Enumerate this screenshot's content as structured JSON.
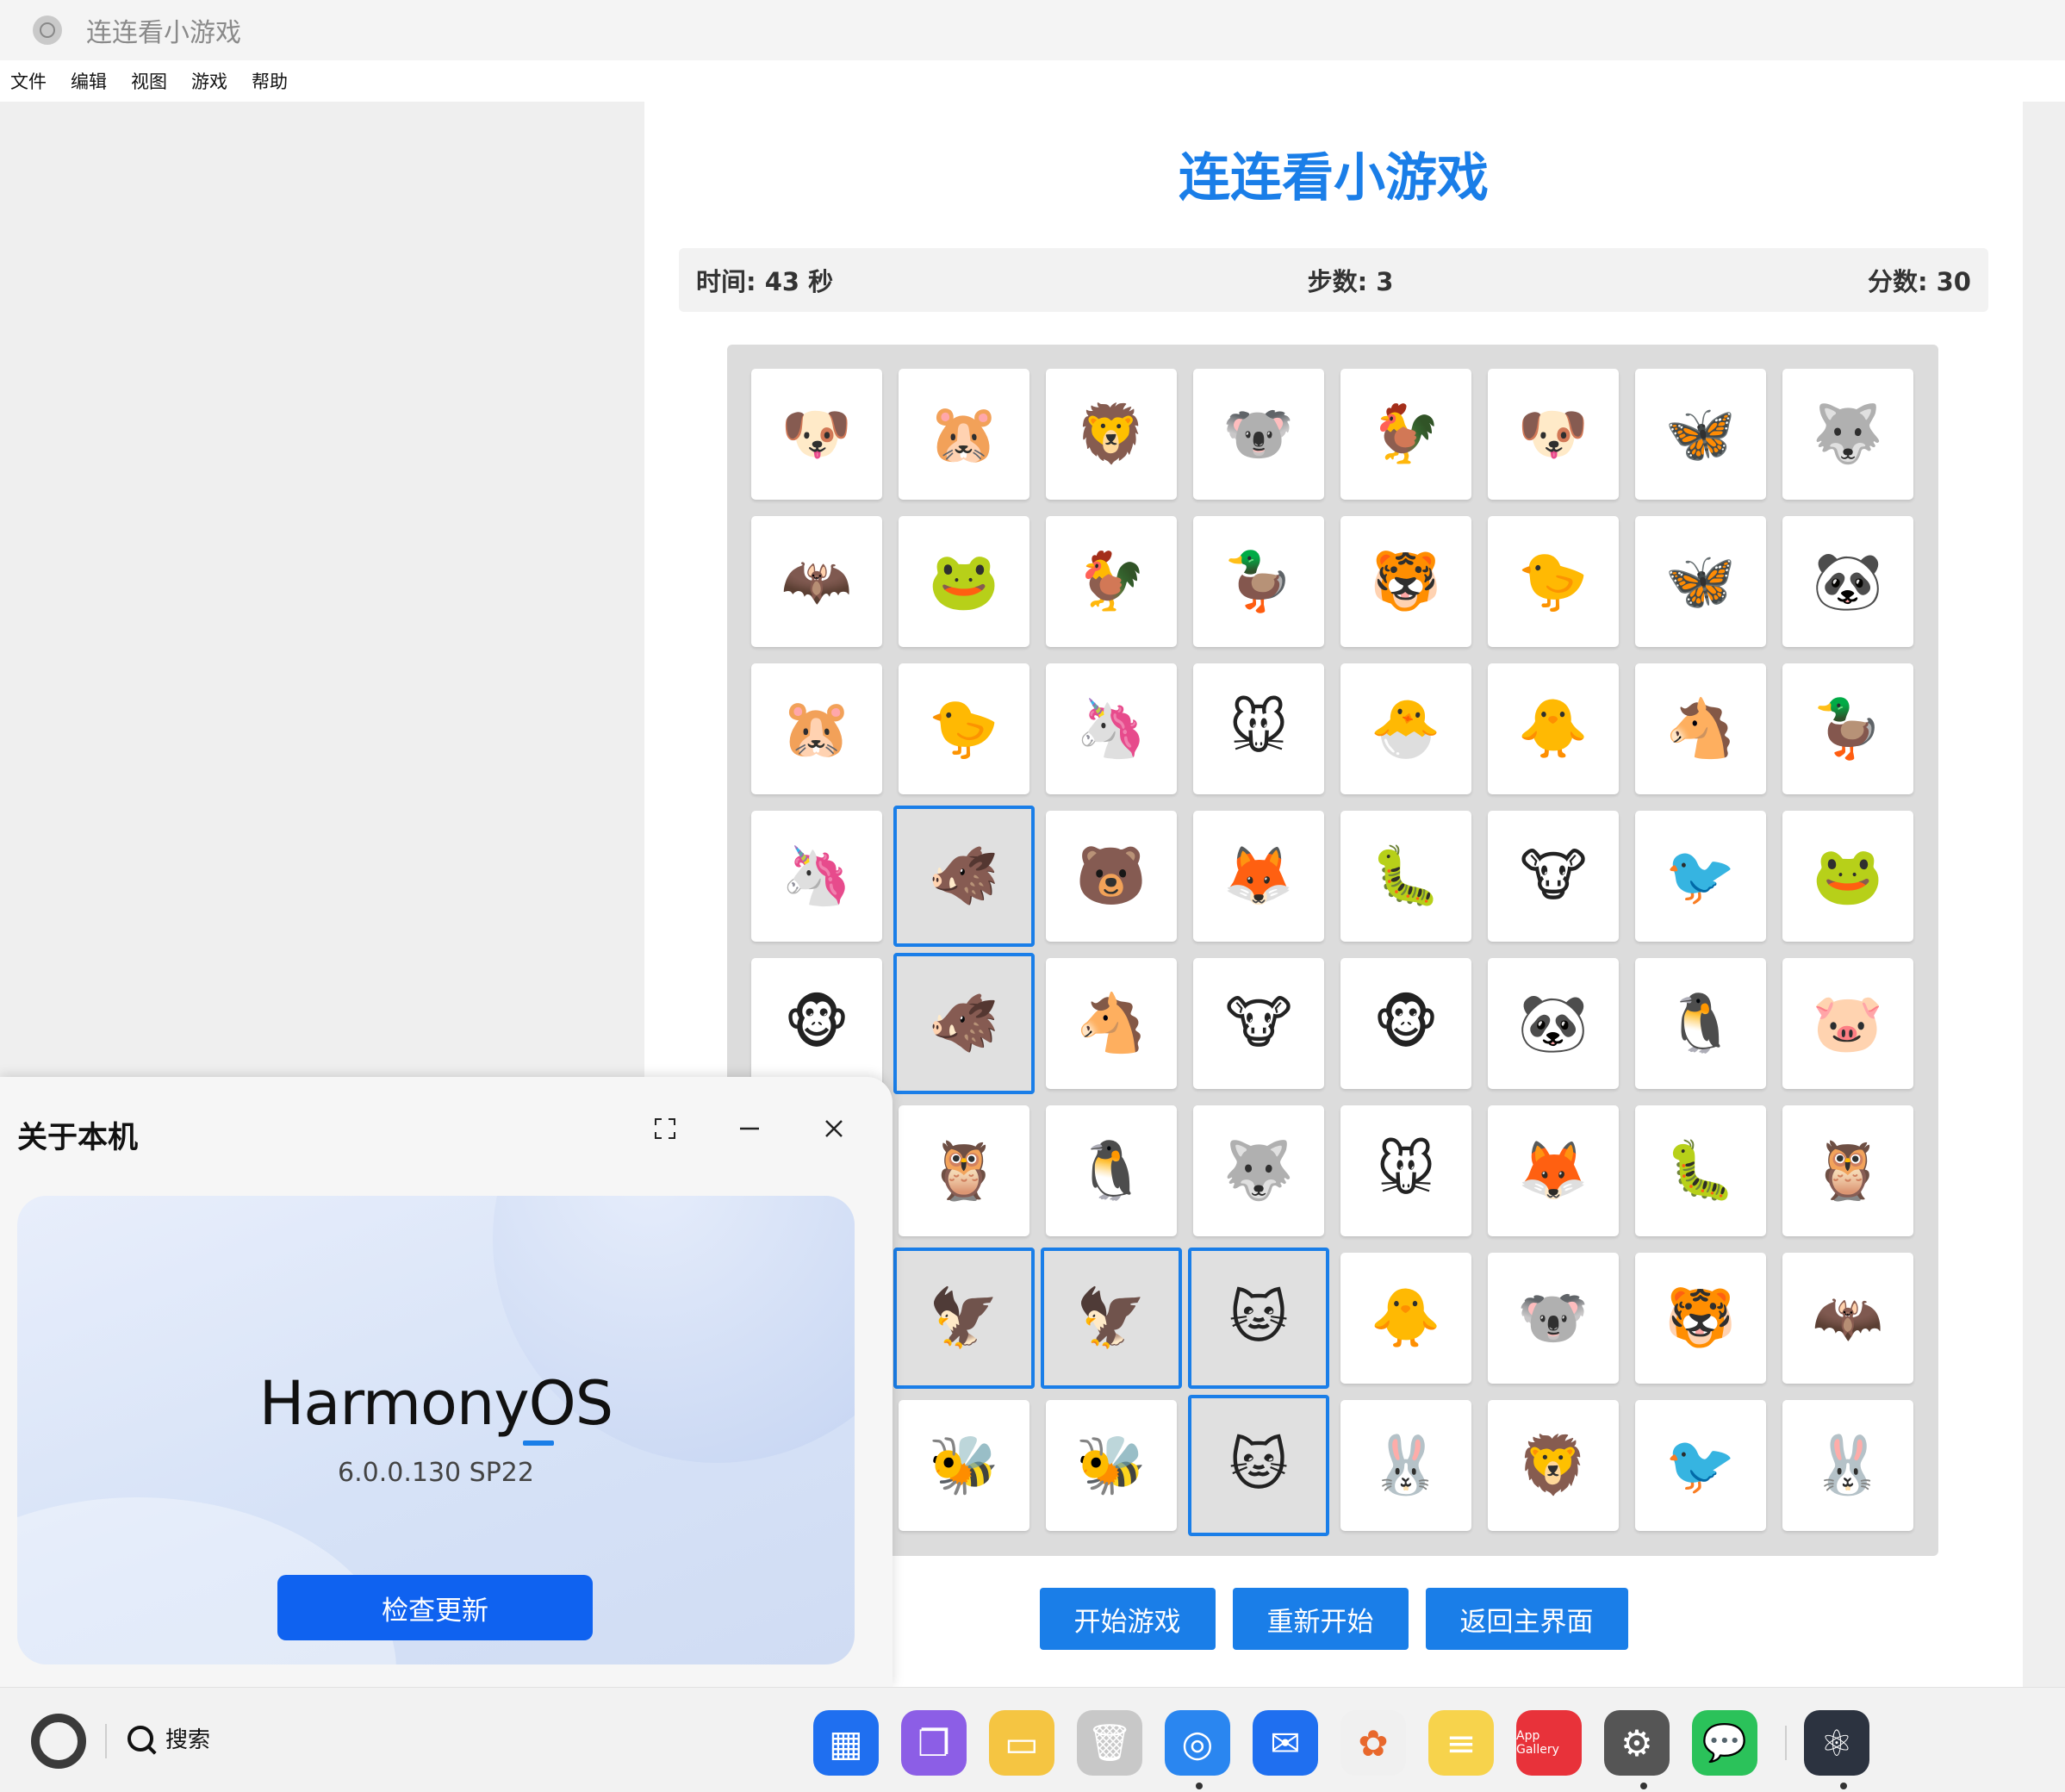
{
  "window": {
    "title": "连连看小游戏"
  },
  "menu": [
    "文件",
    "编辑",
    "视图",
    "游戏",
    "帮助"
  ],
  "game": {
    "title": "连连看小游戏",
    "stats": {
      "time": "时间: 43 秒",
      "steps": "步数: 3",
      "score": "分数: 30"
    },
    "grid": [
      [
        "dog",
        "hamster",
        "lion",
        "koala",
        "rooster",
        "dog",
        "butterfly",
        "wolf"
      ],
      [
        "bat",
        "frog",
        "rooster",
        "duck",
        "tiger",
        "chick",
        "butterfly",
        "panda"
      ],
      [
        "hamster",
        "chick",
        "unicorn",
        "mouse",
        "hatching-chick",
        "baby-chick",
        "horse",
        "duck"
      ],
      [
        "unicorn",
        "boar",
        "bear",
        "fox",
        "bug",
        "cow",
        "bird",
        "frog"
      ],
      [
        "monkey",
        "boar",
        "horse",
        "cow",
        "monkey",
        "panda",
        "penguin",
        "pig"
      ],
      [
        "",
        "owl",
        "penguin",
        "wolf",
        "mouse",
        "fox",
        "bug",
        "owl"
      ],
      [
        "",
        "eagle",
        "eagle",
        "cat",
        "baby-chick",
        "koala",
        "tiger",
        "bat"
      ],
      [
        "",
        "bee",
        "bee",
        "cat",
        "rabbit",
        "lion",
        "bird",
        "rabbit"
      ]
    ],
    "emoji": {
      "dog": "🐶",
      "hamster": "🐹",
      "lion": "🦁",
      "koala": "🐨",
      "rooster": "🐓",
      "butterfly": "🦋",
      "wolf": "🐺",
      "bat": "🦇",
      "frog": "🐸",
      "duck": "🦆",
      "tiger": "🐯",
      "chick": "🐤",
      "panda": "🐼",
      "unicorn": "🦄",
      "mouse": "🐭",
      "hatching-chick": "🐣",
      "baby-chick": "🐥",
      "horse": "🐴",
      "boar": "🐗",
      "bear": "🐻",
      "fox": "🦊",
      "bug": "🐛",
      "cow": "🐮",
      "bird": "🐦",
      "monkey": "🐵",
      "penguin": "🐧",
      "pig": "🐷",
      "owl": "🦉",
      "eagle": "🦅",
      "cat": "🐱",
      "bee": "🐝",
      "rabbit": "🐰"
    },
    "selected": [
      [
        3,
        1
      ],
      [
        4,
        1
      ],
      [
        6,
        1
      ],
      [
        6,
        2
      ],
      [
        6,
        3
      ],
      [
        7,
        3
      ]
    ],
    "buttons": {
      "start": "开始游戏",
      "restart": "重新开始",
      "home": "返回主界面"
    }
  },
  "about": {
    "title": "关于本机",
    "os_name": "HarmonyOS",
    "version": "6.0.0.130 SP22",
    "check_update": "检查更新"
  },
  "taskbar": {
    "search_label": "搜索",
    "apps": [
      {
        "name": "app-center-icon",
        "color": "#1f6ff0",
        "glyph": "▦"
      },
      {
        "name": "multitask-icon",
        "color": "#8c5ee6",
        "glyph": "❐"
      },
      {
        "name": "files-icon",
        "color": "#f5c542",
        "glyph": "▭"
      },
      {
        "name": "trash-icon",
        "color": "#c8c8c8",
        "glyph": "🗑"
      },
      {
        "name": "browser-icon",
        "color": "#2a86f0",
        "glyph": "◎"
      },
      {
        "name": "mail-icon",
        "color": "#1f6ff0",
        "glyph": "✉"
      },
      {
        "name": "photos-icon",
        "color": "#f0f0f0",
        "glyph": "✿"
      },
      {
        "name": "notes-icon",
        "color": "#f7d34c",
        "glyph": "≡"
      },
      {
        "name": "app-gallery-icon",
        "color": "#e8323a",
        "glyph": "A"
      },
      {
        "name": "settings-icon",
        "color": "#555555",
        "glyph": "⚙"
      },
      {
        "name": "wechat-icon",
        "color": "#2bc25a",
        "glyph": "💬"
      },
      {
        "name": "electron-app-icon",
        "color": "#2c3340",
        "glyph": "⚛"
      }
    ],
    "app_gallery_label": "App Gallery"
  }
}
